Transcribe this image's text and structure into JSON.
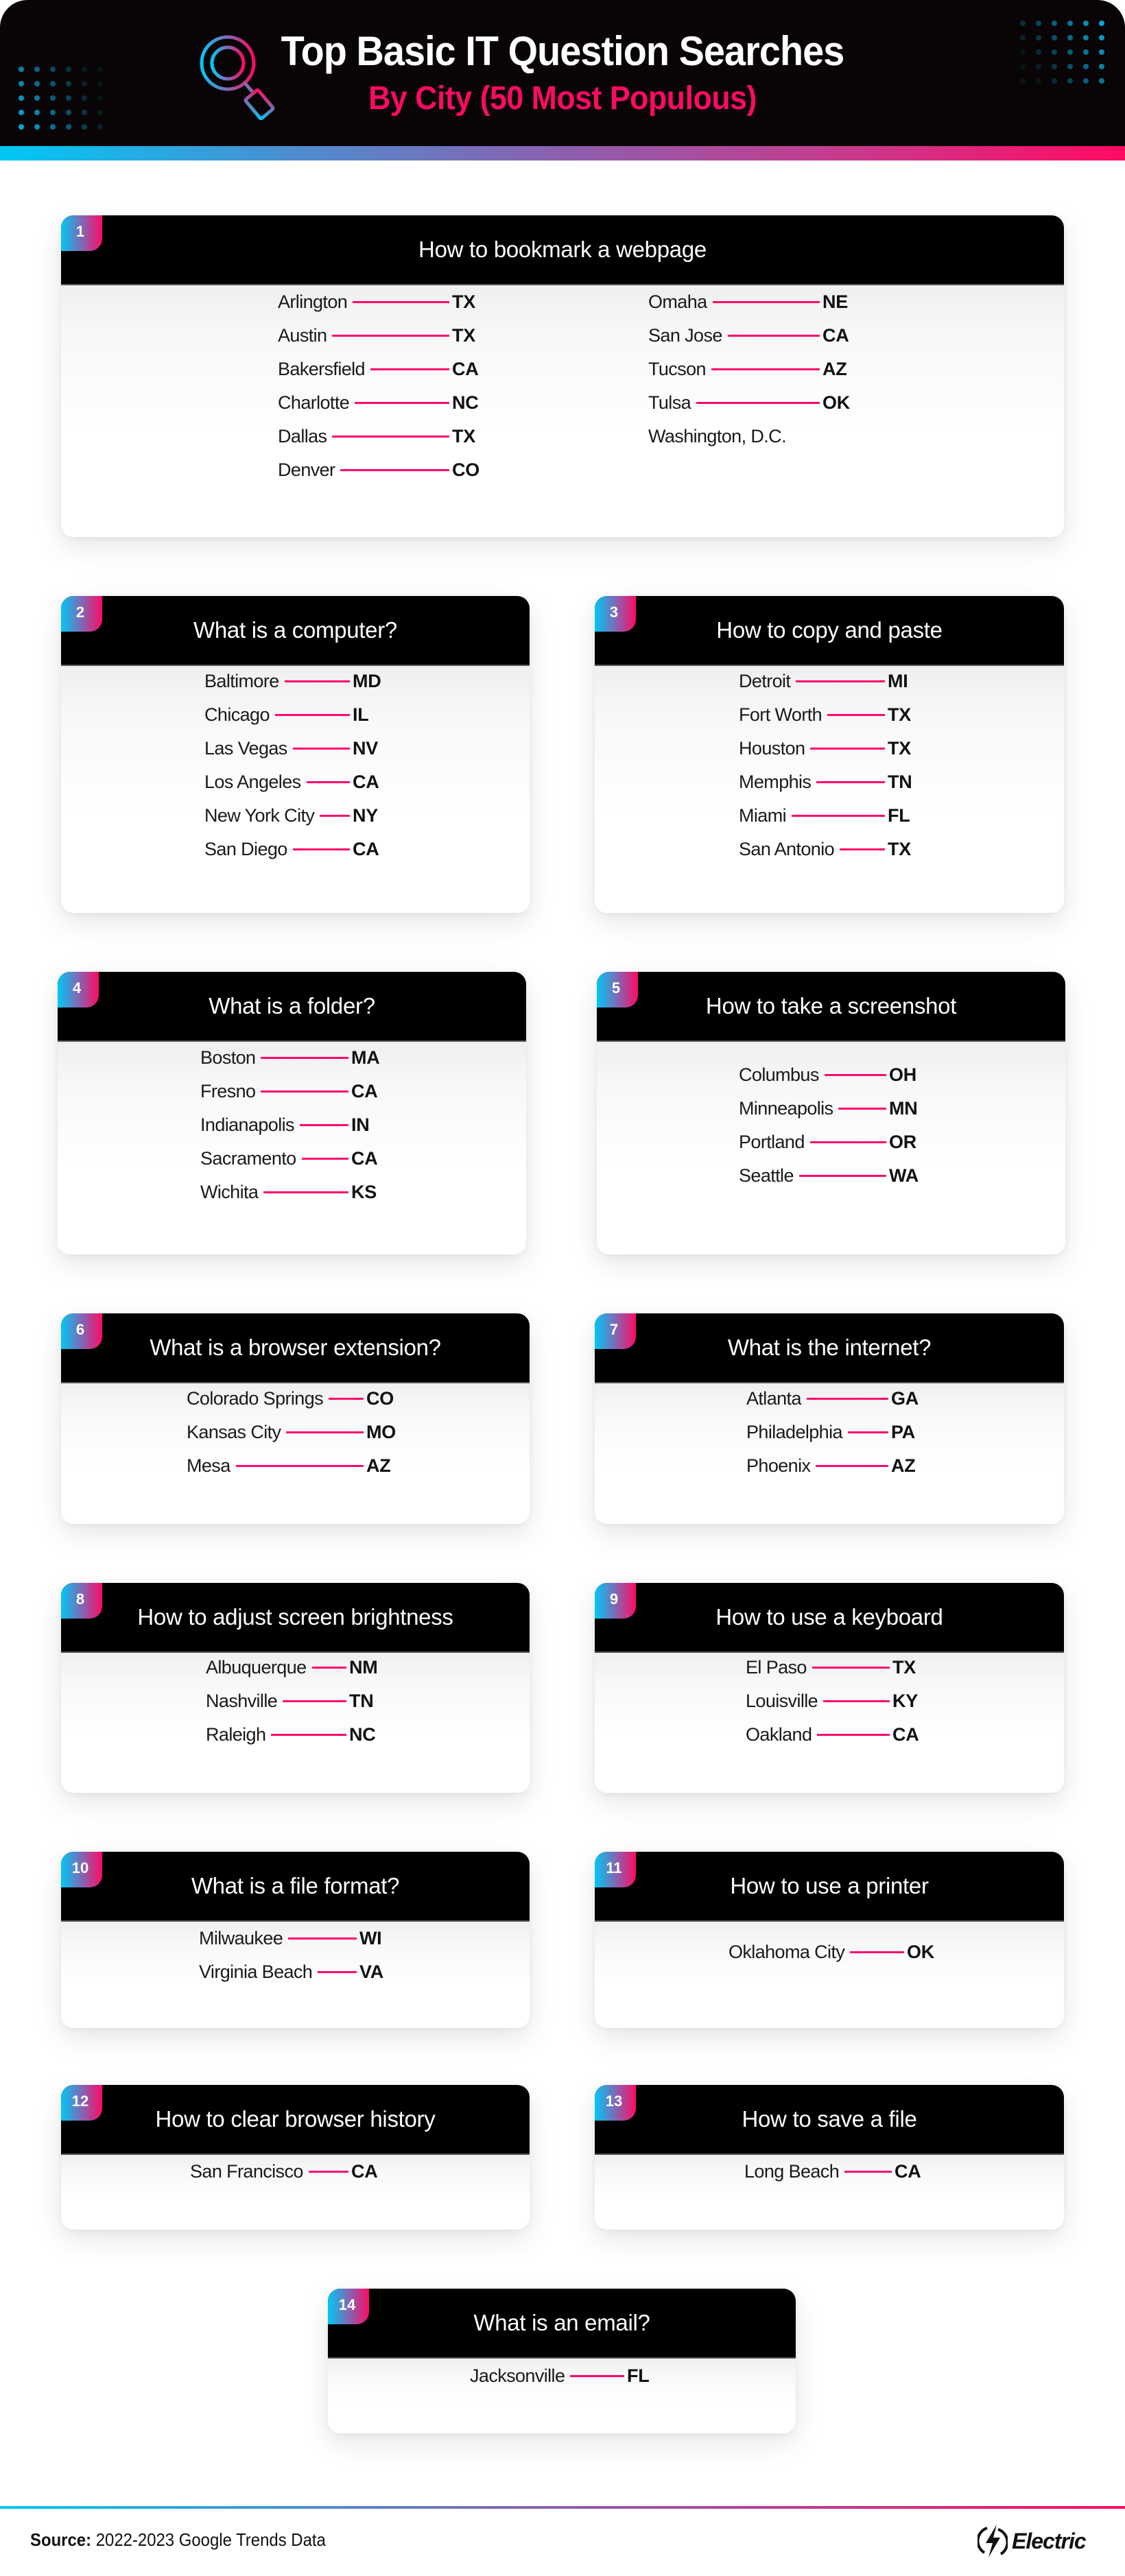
{
  "header": {
    "title": "Top Basic IT Question Searches",
    "subtitle": "By City (50 Most Populous)",
    "icon": "magnifying-glass-icon",
    "colors": {
      "background": "#090506",
      "accent_pink": "#ff0a63",
      "accent_cyan": "#00c8f5"
    }
  },
  "cards": [
    {
      "rank": "1",
      "question": "How to bookmark a webpage",
      "cities": [
        {
          "city": "Arlington",
          "state": "TX"
        },
        {
          "city": "Austin",
          "state": "TX"
        },
        {
          "city": "Bakersfield",
          "state": "CA"
        },
        {
          "city": "Charlotte",
          "state": "NC"
        },
        {
          "city": "Dallas",
          "state": "TX"
        },
        {
          "city": "Denver",
          "state": "CO"
        },
        {
          "city": "Omaha",
          "state": "NE"
        },
        {
          "city": "San Jose",
          "state": "CA"
        },
        {
          "city": "Tucson",
          "state": "AZ"
        },
        {
          "city": "Tulsa",
          "state": "OK"
        },
        {
          "city": "Washington, D.C.",
          "state": ""
        }
      ]
    },
    {
      "rank": "2",
      "question": "What is a computer?",
      "cities": [
        {
          "city": "Baltimore",
          "state": "MD"
        },
        {
          "city": "Chicago",
          "state": "IL"
        },
        {
          "city": "Las Vegas",
          "state": "NV"
        },
        {
          "city": "Los Angeles",
          "state": "CA"
        },
        {
          "city": "New York City",
          "state": "NY"
        },
        {
          "city": "San Diego",
          "state": "CA"
        }
      ]
    },
    {
      "rank": "3",
      "question": "How to copy and paste",
      "cities": [
        {
          "city": "Detroit",
          "state": "MI"
        },
        {
          "city": "Fort Worth",
          "state": "TX"
        },
        {
          "city": "Houston",
          "state": "TX"
        },
        {
          "city": "Memphis",
          "state": "TN"
        },
        {
          "city": "Miami",
          "state": "FL"
        },
        {
          "city": "San Antonio",
          "state": "TX"
        }
      ]
    },
    {
      "rank": "4",
      "question": "What is a folder?",
      "cities": [
        {
          "city": "Boston",
          "state": "MA"
        },
        {
          "city": "Fresno",
          "state": "CA"
        },
        {
          "city": "Indianapolis",
          "state": "IN"
        },
        {
          "city": "Sacramento",
          "state": "CA"
        },
        {
          "city": "Wichita",
          "state": "KS"
        }
      ]
    },
    {
      "rank": "5",
      "question": "How to take a screenshot",
      "cities": [
        {
          "city": "Columbus",
          "state": "OH"
        },
        {
          "city": "Minneapolis",
          "state": "MN"
        },
        {
          "city": "Portland",
          "state": "OR"
        },
        {
          "city": "Seattle",
          "state": "WA"
        }
      ]
    },
    {
      "rank": "6",
      "question": "What is a browser extension?",
      "cities": [
        {
          "city": "Colorado Springs",
          "state": "CO"
        },
        {
          "city": "Kansas City",
          "state": "MO"
        },
        {
          "city": "Mesa",
          "state": "AZ"
        }
      ]
    },
    {
      "rank": "7",
      "question": "What is the internet?",
      "cities": [
        {
          "city": "Atlanta",
          "state": "GA"
        },
        {
          "city": "Philadelphia",
          "state": "PA"
        },
        {
          "city": "Phoenix",
          "state": "AZ"
        }
      ]
    },
    {
      "rank": "8",
      "question": "How to adjust screen brightness",
      "cities": [
        {
          "city": "Albuquerque",
          "state": "NM"
        },
        {
          "city": "Nashville",
          "state": "TN"
        },
        {
          "city": "Raleigh",
          "state": "NC"
        }
      ]
    },
    {
      "rank": "9",
      "question": "How to use a keyboard",
      "cities": [
        {
          "city": "El Paso",
          "state": "TX"
        },
        {
          "city": "Louisville",
          "state": "KY"
        },
        {
          "city": "Oakland",
          "state": "CA"
        }
      ]
    },
    {
      "rank": "10",
      "question": "What is a file format?",
      "cities": [
        {
          "city": "Milwaukee",
          "state": "WI"
        },
        {
          "city": "Virginia Beach",
          "state": "VA"
        }
      ]
    },
    {
      "rank": "11",
      "question": "How to use a printer",
      "cities": [
        {
          "city": "Oklahoma City",
          "state": "OK"
        }
      ]
    },
    {
      "rank": "12",
      "question": "How to clear browser history",
      "cities": [
        {
          "city": "San Francisco",
          "state": "CA"
        }
      ]
    },
    {
      "rank": "13",
      "question": "How to save a file",
      "cities": [
        {
          "city": "Long Beach",
          "state": "CA"
        }
      ]
    },
    {
      "rank": "14",
      "question": "What is an email?",
      "cities": [
        {
          "city": "Jacksonville",
          "state": "FL"
        }
      ]
    }
  ],
  "footer": {
    "source_label": "Source:",
    "source_text": " 2022-2023 Google Trends Data",
    "brand": "Electric",
    "brand_icon": "lightning-bolt-icon"
  }
}
